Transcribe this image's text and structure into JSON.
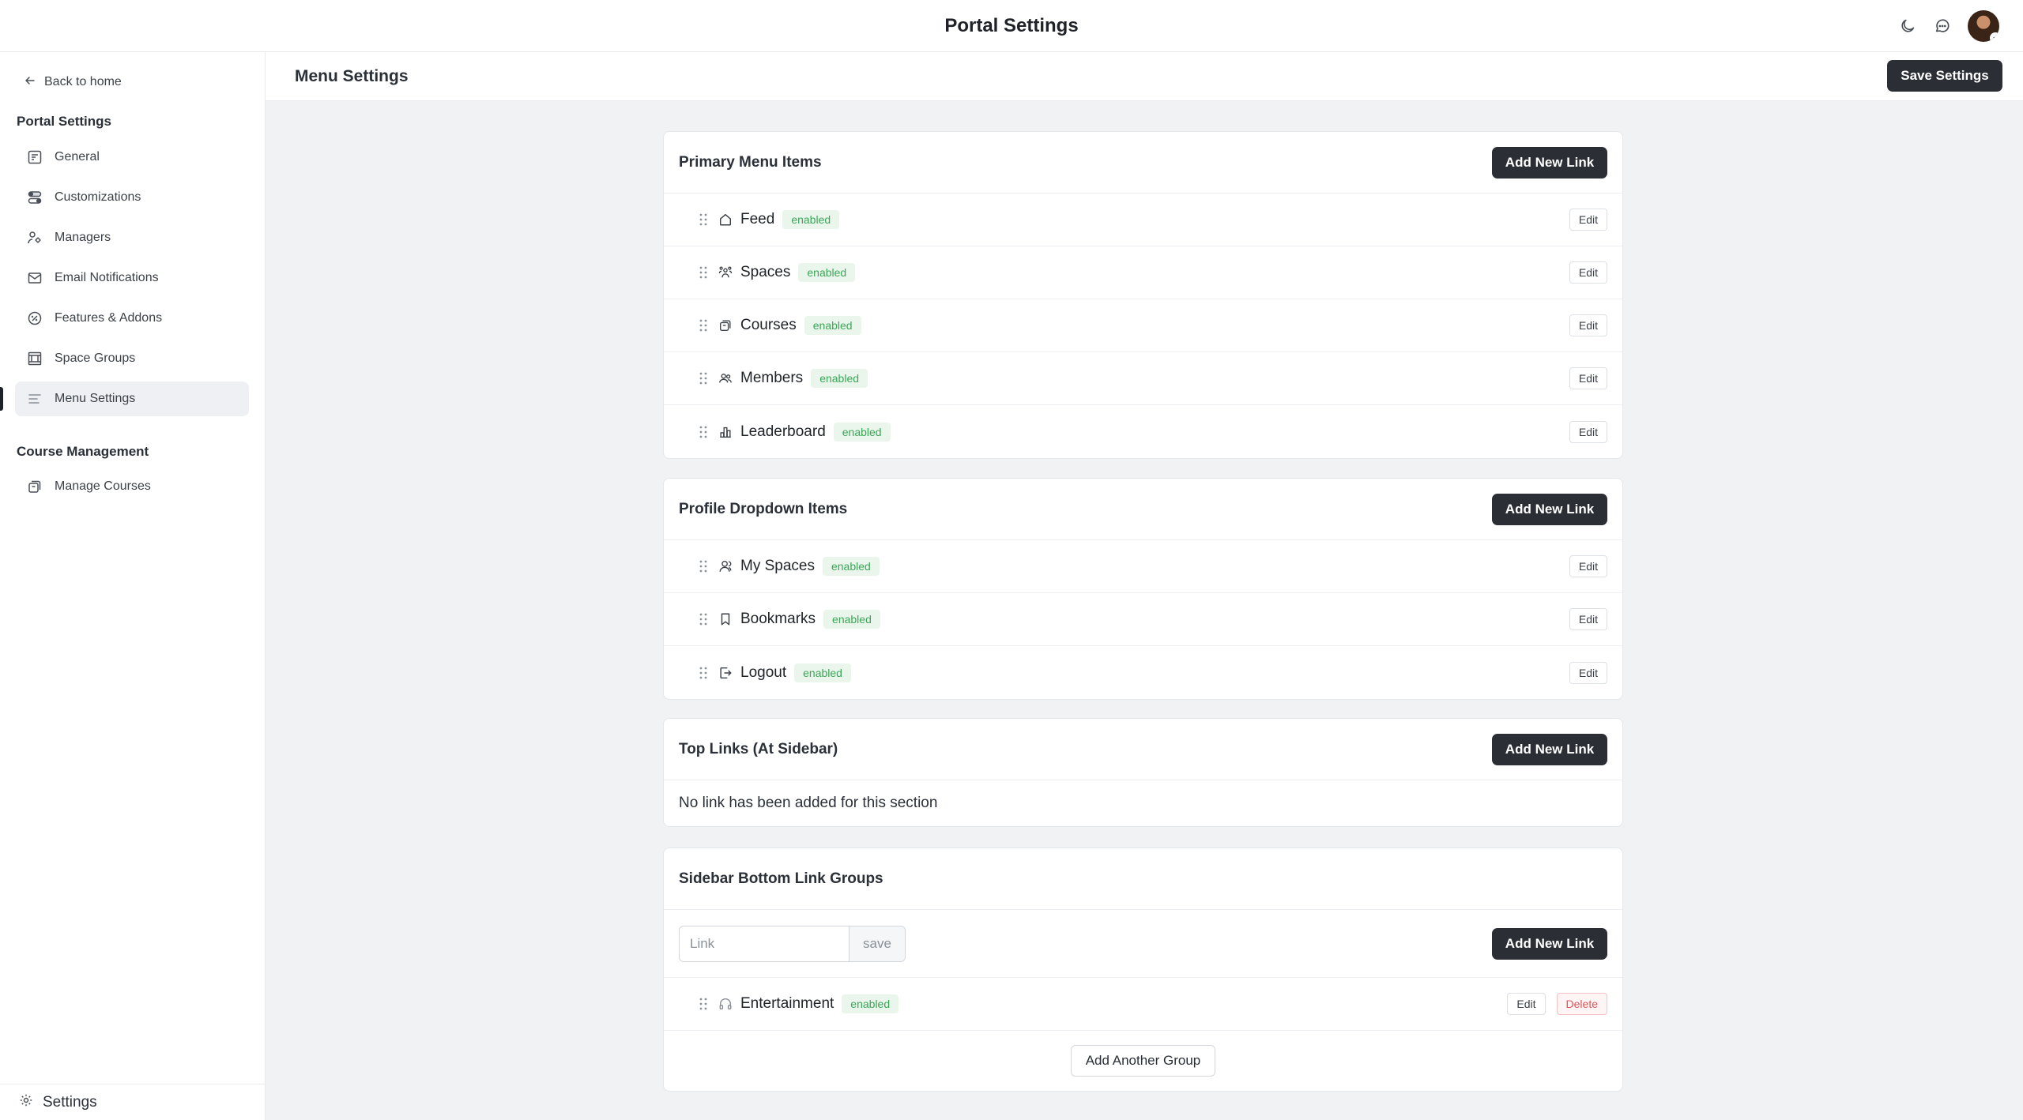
{
  "topbar": {
    "title": "Portal Settings",
    "icons": [
      "moon-icon",
      "chat-icon"
    ],
    "avatar": "user-avatar"
  },
  "sidebar": {
    "back_label": "Back to home",
    "portal_heading": "Portal Settings",
    "portal_items": [
      {
        "label": "General",
        "icon": "general-icon"
      },
      {
        "label": "Customizations",
        "icon": "toggles-icon"
      },
      {
        "label": "Managers",
        "icon": "managers-icon"
      },
      {
        "label": "Email Notifications",
        "icon": "mail-icon"
      },
      {
        "label": "Features & Addons",
        "icon": "features-icon"
      },
      {
        "label": "Space Groups",
        "icon": "space-groups-icon"
      },
      {
        "label": "Menu Settings",
        "icon": "menu-icon",
        "active": true
      }
    ],
    "course_heading": "Course Management",
    "course_items": [
      {
        "label": "Manage Courses",
        "icon": "courses-icon"
      }
    ],
    "footer_label": "Settings"
  },
  "main": {
    "title": "Menu Settings",
    "save_label": "Save Settings"
  },
  "labels": {
    "add_new_link": "Add New Link",
    "edit": "Edit",
    "delete": "Delete",
    "enabled": "enabled"
  },
  "primary_menu": {
    "title": "Primary Menu Items",
    "items": [
      {
        "label": "Feed",
        "status": "enabled",
        "icon": "home-icon"
      },
      {
        "label": "Spaces",
        "status": "enabled",
        "icon": "spaces-icon"
      },
      {
        "label": "Courses",
        "status": "enabled",
        "icon": "courses-icon"
      },
      {
        "label": "Members",
        "status": "enabled",
        "icon": "members-icon"
      },
      {
        "label": "Leaderboard",
        "status": "enabled",
        "icon": "leaderboard-icon"
      }
    ]
  },
  "profile_dropdown": {
    "title": "Profile Dropdown Items",
    "items": [
      {
        "label": "My Spaces",
        "status": "enabled",
        "icon": "user-icon"
      },
      {
        "label": "Bookmarks",
        "status": "enabled",
        "icon": "bookmark-icon"
      },
      {
        "label": "Logout",
        "status": "enabled",
        "icon": "logout-icon"
      }
    ]
  },
  "top_links": {
    "title": "Top Links (At Sidebar)",
    "empty_text": "No link has been added for this section"
  },
  "sidebar_bottom": {
    "title": "Sidebar Bottom Link Groups",
    "link_placeholder": "Link",
    "link_value": "",
    "save_label": "save",
    "items": [
      {
        "label": "Entertainment",
        "status": "enabled",
        "icon": "headphones-icon"
      }
    ],
    "add_group_label": "Add Another Group"
  },
  "colors": {
    "accent_dark": "#2b2f35",
    "enabled_green": "#3aa757",
    "delete_red": "#e0555a",
    "main_bg": "#f0f2f4"
  }
}
